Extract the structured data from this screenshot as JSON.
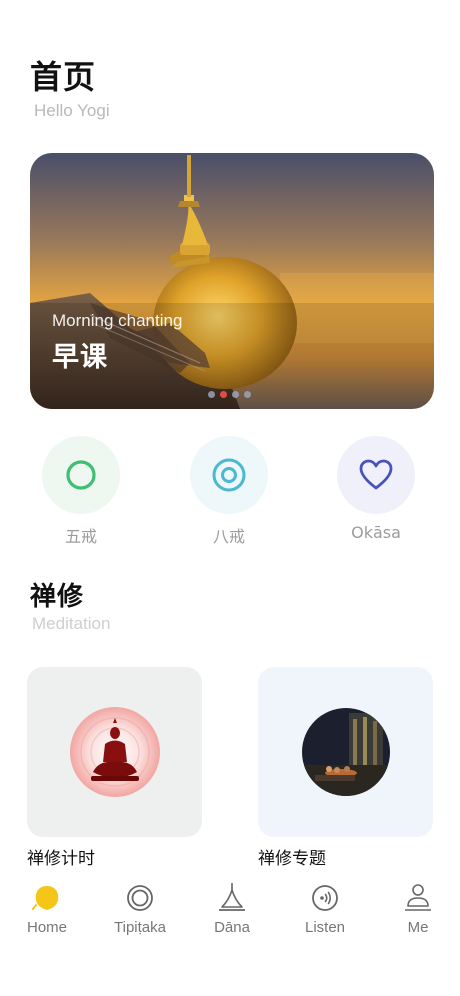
{
  "header": {
    "title": "首页",
    "subtitle": "Hello Yogi"
  },
  "banner": {
    "subtitle": "Morning chanting",
    "title": "早课",
    "slide_count": 4,
    "active_slide": 2,
    "colors": {
      "active_dot": "#e64b4b"
    }
  },
  "quick_actions": [
    {
      "label": "五戒",
      "icon": "ring-icon",
      "color": "#3fbf73"
    },
    {
      "label": "八戒",
      "icon": "target-icon",
      "color": "#4ab8d0"
    },
    {
      "label": "Okāsa",
      "icon": "heart-icon",
      "color": "#4a54b8"
    }
  ],
  "meditation": {
    "title": "禅修",
    "subtitle": "Meditation",
    "cards": [
      {
        "label": "禅修计时",
        "icon": "buddha-icon"
      },
      {
        "label": "禅修专题",
        "icon": "night-temple-icon"
      }
    ]
  },
  "tabbar": {
    "items": [
      {
        "label": "Home",
        "icon": "bodhi-leaf-icon",
        "active": true,
        "color": "#f5c518"
      },
      {
        "label": "Tipiṭaka",
        "icon": "dharma-wheel-icon",
        "active": false
      },
      {
        "label": "Dāna",
        "icon": "pagoda-icon",
        "active": false
      },
      {
        "label": "Listen",
        "icon": "audio-icon",
        "active": false
      },
      {
        "label": "Me",
        "icon": "person-icon",
        "active": false
      }
    ]
  }
}
